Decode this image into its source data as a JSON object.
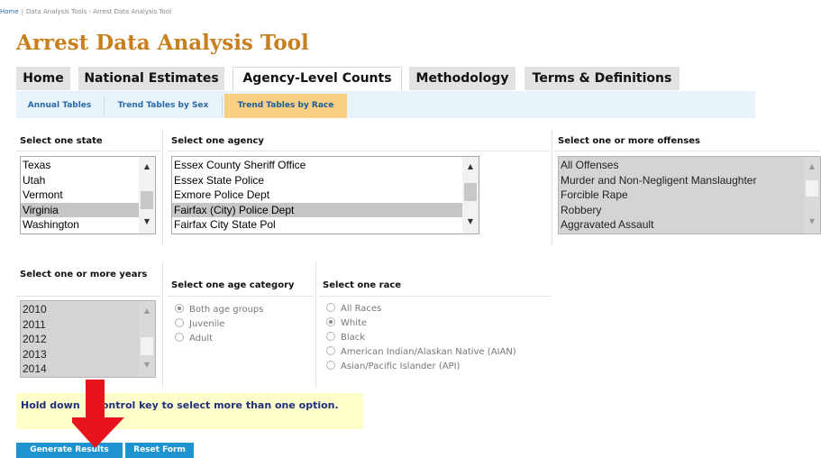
{
  "breadcrumb": {
    "home": "Home",
    "separator": "|",
    "trail": "Data Analysis Tools - Arrest Data Analysis Tool"
  },
  "title": "Arrest Data Analysis Tool",
  "main_tabs": [
    {
      "label": "Home",
      "active": false
    },
    {
      "label": "National Estimates",
      "active": false
    },
    {
      "label": "Agency-Level Counts",
      "active": true
    },
    {
      "label": "Methodology",
      "active": false
    },
    {
      "label": "Terms & Definitions",
      "active": false
    }
  ],
  "sub_tabs": [
    {
      "label": "Annual Tables",
      "active": false
    },
    {
      "label": "Trend Tables by Sex",
      "active": false
    },
    {
      "label": "Trend Tables by Race",
      "active": true
    }
  ],
  "state": {
    "label": "Select one state",
    "options": [
      "Texas",
      "Utah",
      "Vermont",
      "Virginia",
      "Washington"
    ],
    "selected": "Virginia"
  },
  "agency": {
    "label": "Select one agency",
    "options": [
      "Essex County Sheriff Office",
      "Essex State Police",
      "Exmore Police Dept",
      "Fairfax (City) Police Dept",
      "Fairfax City State Pol"
    ],
    "selected": "Fairfax (City) Police Dept"
  },
  "offenses": {
    "label": "Select one or more offenses",
    "options": [
      "All Offenses",
      "Murder and Non-Negligent Manslaughter",
      "Forcible Rape",
      "Robbery",
      "Aggravated Assault"
    ],
    "disabled": true
  },
  "years": {
    "label": "Select one or more years",
    "options": [
      "2010",
      "2011",
      "2012",
      "2013",
      "2014"
    ],
    "disabled": true
  },
  "age": {
    "label": "Select one age category",
    "options": [
      {
        "label": "Both age groups",
        "checked": true
      },
      {
        "label": "Juvenile",
        "checked": false
      },
      {
        "label": "Adult",
        "checked": false
      }
    ]
  },
  "race": {
    "label": "Select one race",
    "options": [
      {
        "label": "All Races",
        "checked": false
      },
      {
        "label": "White",
        "checked": true
      },
      {
        "label": "Black",
        "checked": false
      },
      {
        "label": "American Indian/Alaskan Native (AIAN)",
        "checked": false
      },
      {
        "label": "Asian/Pacific Islander (API)",
        "checked": false
      }
    ]
  },
  "note": {
    "part1": "Hold down",
    "part2": "control key to select more than one option."
  },
  "buttons": {
    "generate": "Generate Results",
    "reset": "Reset Form"
  },
  "icons": {
    "scroll_up": "▲",
    "scroll_down": "▼",
    "arrow": "red-down-arrow"
  },
  "colors": {
    "title": "#c8801e",
    "active_subtab": "#f9cf82",
    "button": "#1f93cf",
    "note_bg": "#ffffcc",
    "arrow": "#e8141c"
  }
}
